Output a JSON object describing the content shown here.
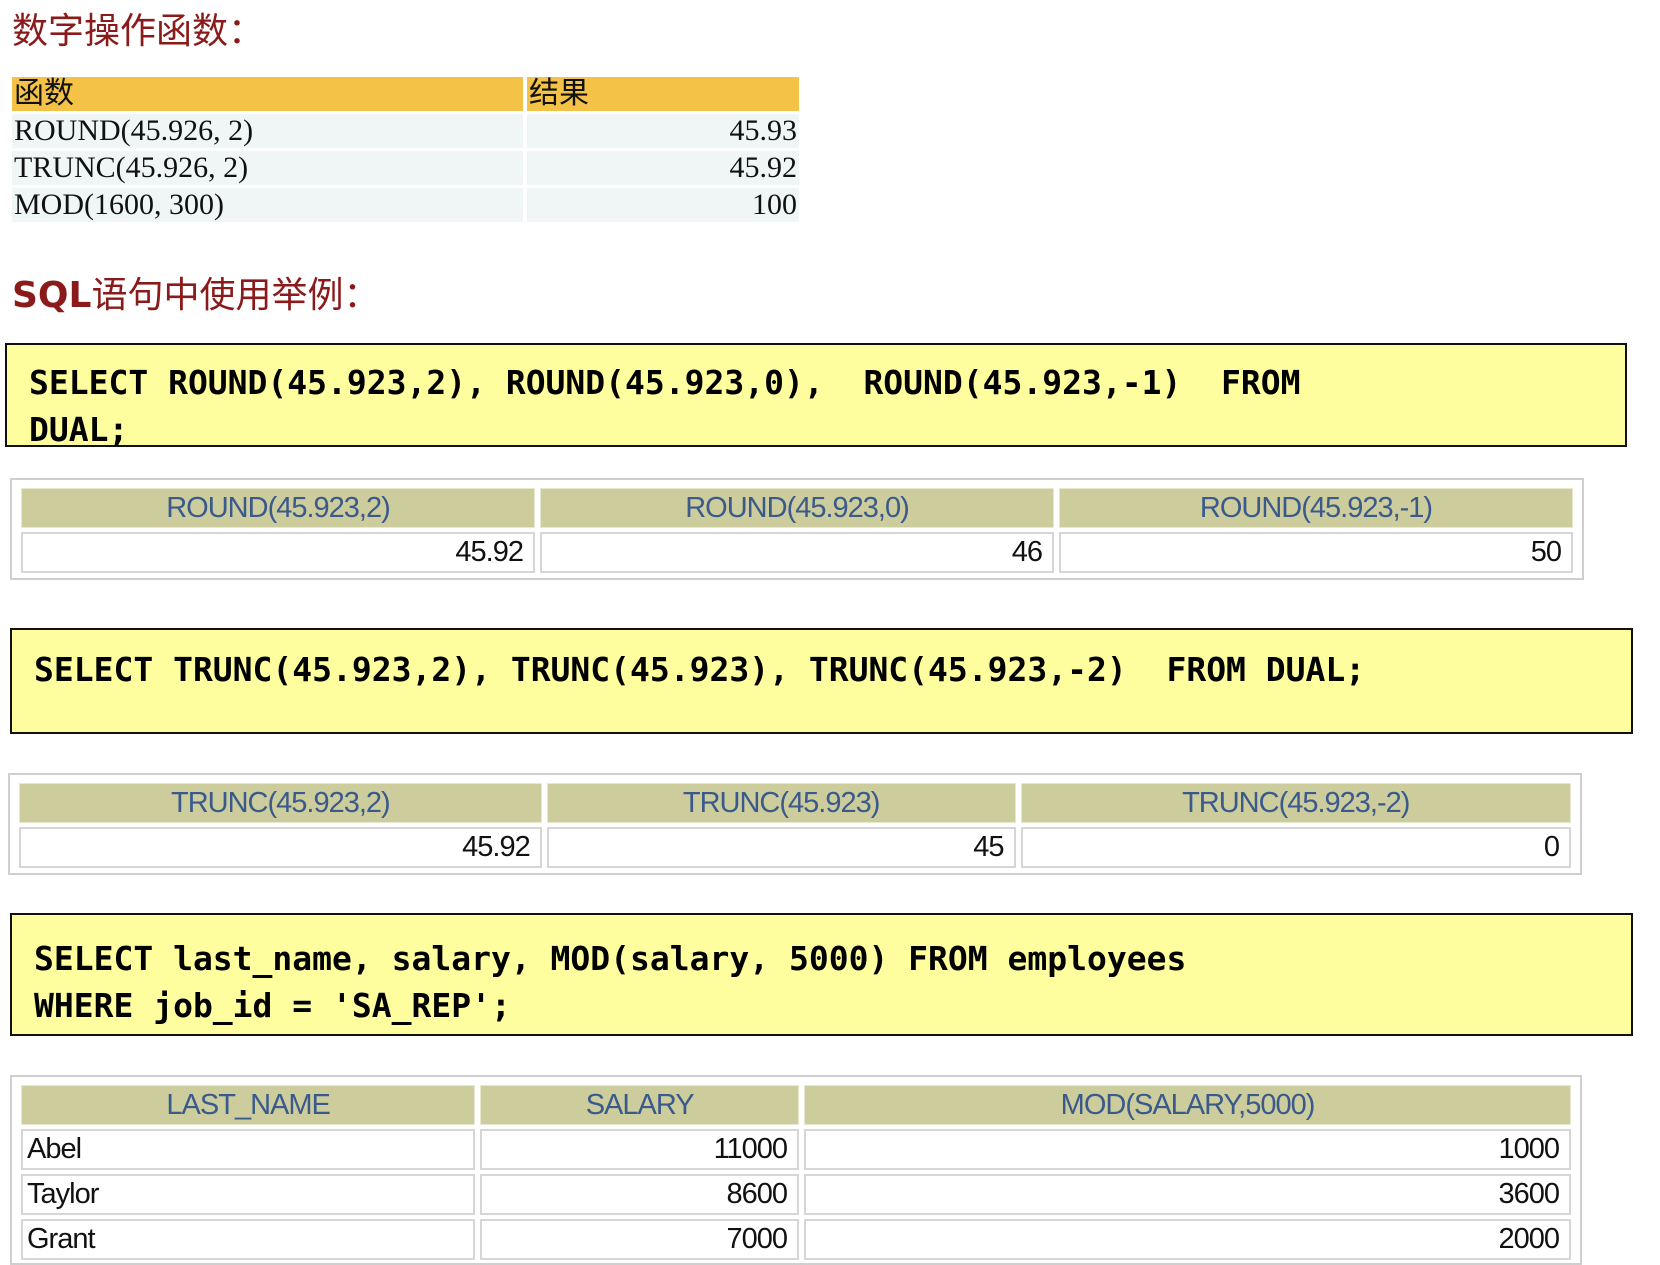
{
  "sections": {
    "number_functions_title": "数字操作函数：",
    "sql_examples_title_prefix": "SQL",
    "sql_examples_title_suffix": "语句中使用举例："
  },
  "summary_table": {
    "headers": [
      "函数",
      "结果"
    ],
    "rows": [
      [
        "ROUND(45.926, 2)",
        "45.93"
      ],
      [
        "TRUNC(45.926, 2)",
        "45.92"
      ],
      [
        "MOD(1600, 300)",
        "100"
      ]
    ],
    "header_color": "#f4c246"
  },
  "examples": [
    {
      "sql_lines": [
        "SELECT ROUND(45.923,2), ROUND(45.923,0),  ROUND(45.923,-1)  FROM",
        "DUAL;"
      ],
      "result": {
        "headers": [
          "ROUND(45.923,2)",
          "ROUND(45.923,0)",
          "ROUND(45.923,-1)"
        ],
        "rows": [
          [
            "45.92",
            "46",
            "50"
          ]
        ]
      }
    },
    {
      "sql_lines": [
        "SELECT TRUNC(45.923,2), TRUNC(45.923), TRUNC(45.923,-2)  FROM DUAL;"
      ],
      "result": {
        "headers": [
          "TRUNC(45.923,2)",
          "TRUNC(45.923)",
          "TRUNC(45.923,-2)"
        ],
        "rows": [
          [
            "45.92",
            "45",
            "0"
          ]
        ]
      }
    },
    {
      "sql_lines": [
        "SELECT last_name, salary, MOD(salary, 5000) FROM employees",
        "WHERE job_id = 'SA_REP';"
      ],
      "result": {
        "headers": [
          "LAST_NAME",
          "SALARY",
          "MOD(SALARY,5000)"
        ],
        "rows": [
          [
            "Abel",
            "11000",
            "1000"
          ],
          [
            "Taylor",
            "8600",
            "3600"
          ],
          [
            "Grant",
            "7000",
            "2000"
          ]
        ]
      }
    }
  ],
  "colors": {
    "heading": "#8b1a1a",
    "code_background": "#fefe9e",
    "grid_header_background": "#cccc9c",
    "grid_header_text": "#3a5a8c"
  }
}
